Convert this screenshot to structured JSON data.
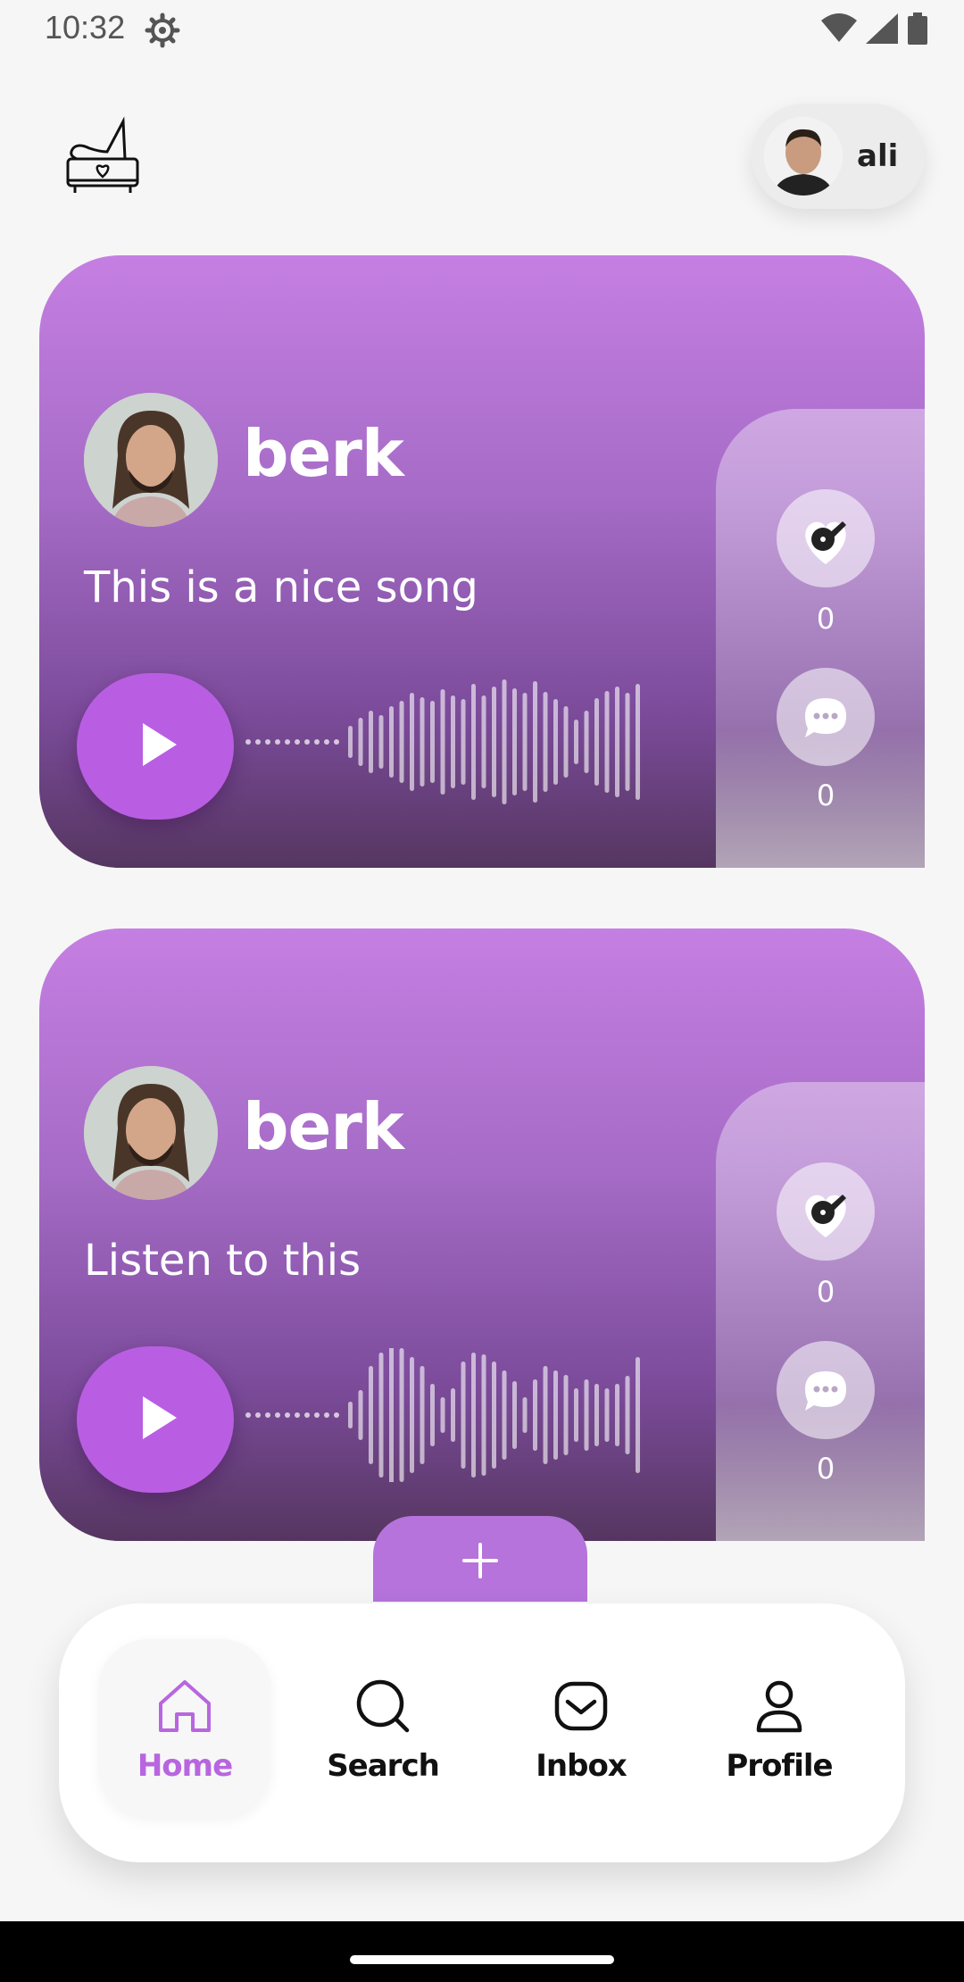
{
  "status_bar": {
    "time": "10:32"
  },
  "header": {
    "user_name": "ali"
  },
  "posts": [
    {
      "author": "berk",
      "text": "This is a nice song",
      "likes": "0",
      "comments": "0"
    },
    {
      "author": "berk",
      "text": "Listen to this",
      "likes": "0",
      "comments": "0"
    }
  ],
  "nav": {
    "items": [
      {
        "label": "Home",
        "icon": "home-icon",
        "active": true
      },
      {
        "label": "Search",
        "icon": "search-icon"
      },
      {
        "label": "Inbox",
        "icon": "inbox-icon"
      },
      {
        "label": "Profile",
        "icon": "profile-icon"
      }
    ]
  },
  "colors": {
    "accent": "#b95ee2",
    "card_top": "#c57fe2",
    "card_bottom": "#553660",
    "active_nav": "#b866e0"
  }
}
